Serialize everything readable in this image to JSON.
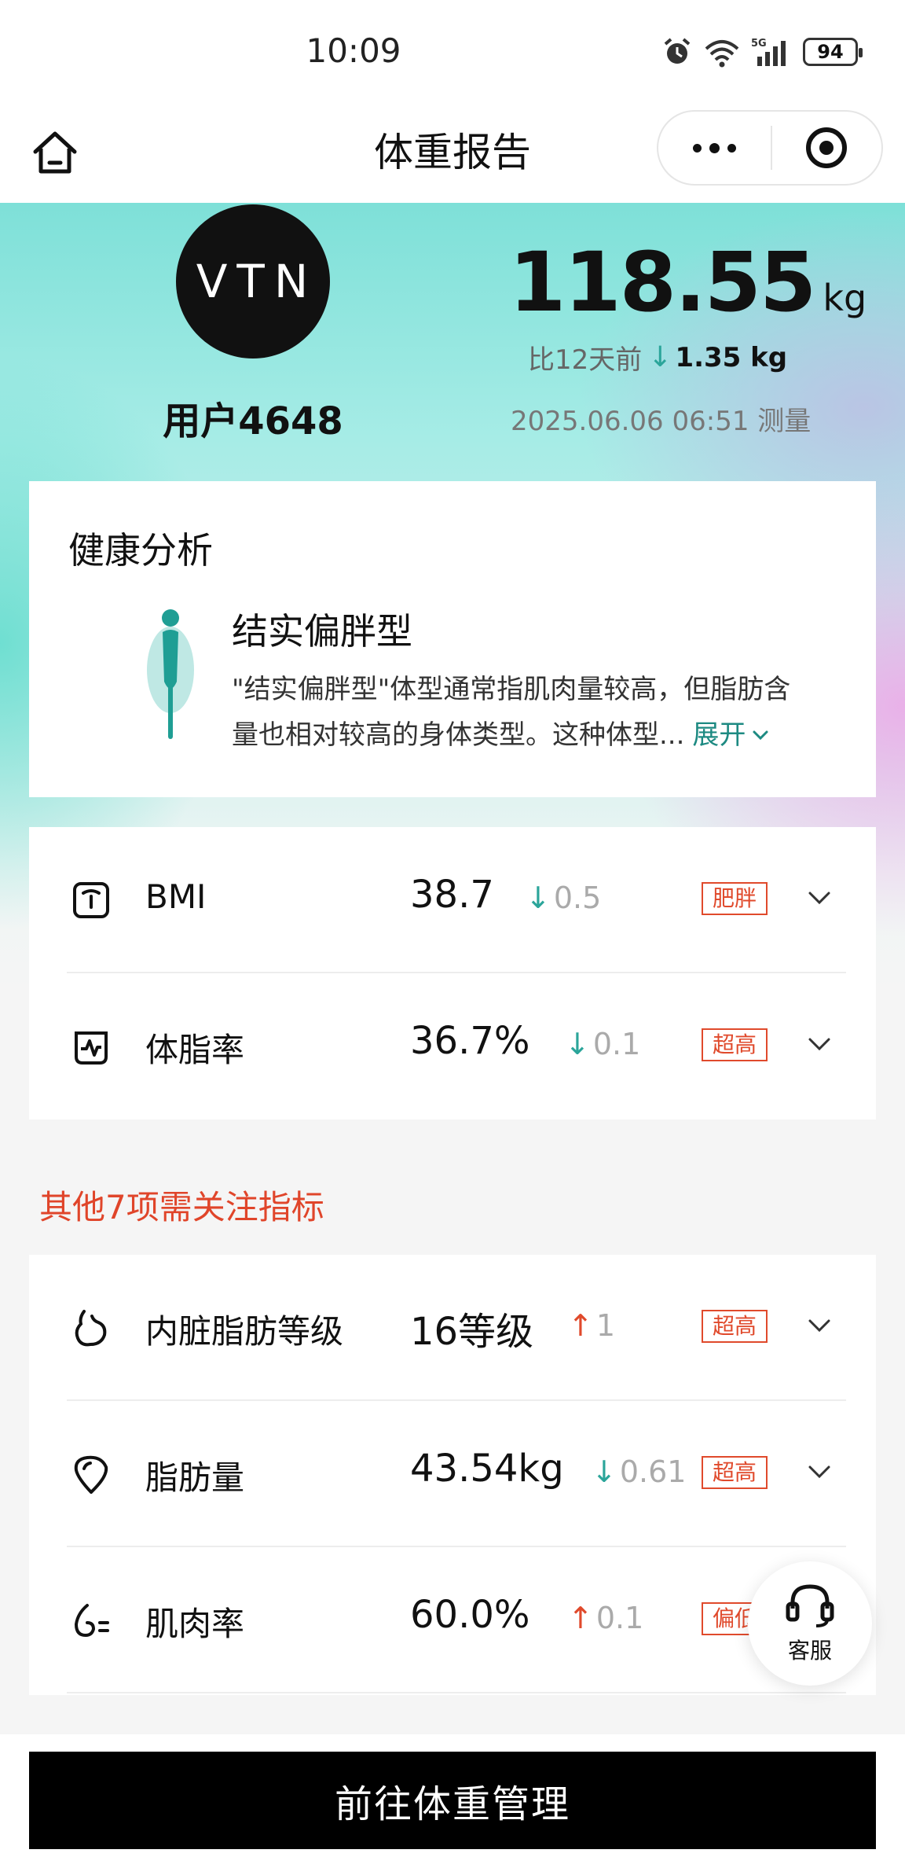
{
  "status_bar": {
    "time": "10:09",
    "battery": "94"
  },
  "nav": {
    "title": "体重报告"
  },
  "profile": {
    "logo_text": "VTN",
    "username": "用户4648",
    "weight_value": "118.55",
    "weight_unit": "kg",
    "compare_prefix": "比12天前",
    "compare_arrow": "↓",
    "compare_delta": "1.35 kg",
    "measured_at": "2025.06.06 06:51 测量"
  },
  "health": {
    "title": "健康分析",
    "type_name": "结实偏胖型",
    "desc_line1": "\"结实偏胖型\"体型通常指肌肉量较高，但脂肪含",
    "desc_line2": "量也相对较高的身体类型。这种体型...",
    "expand_label": "展开"
  },
  "key_metrics": [
    {
      "name": "BMI",
      "value": "38.7",
      "arrow": "↓",
      "change": "0.5",
      "badge": "肥胖",
      "icon": "bmi-icon"
    },
    {
      "name": "体脂率",
      "value": "36.7%",
      "arrow": "↓",
      "change": "0.1",
      "badge": "超高",
      "icon": "body-fat-icon"
    }
  ],
  "section_label": "其他7项需关注指标",
  "other_metrics": [
    {
      "name": "内脏脂肪等级",
      "value": "16等级",
      "arrow": "↑",
      "change": "1",
      "badge": "超高",
      "icon": "visceral-fat-icon"
    },
    {
      "name": "脂肪量",
      "value": "43.54kg",
      "arrow": "↓",
      "change": "0.61",
      "badge": "超高",
      "icon": "fat-mass-icon"
    },
    {
      "name": "肌肉率",
      "value": "60.0%",
      "arrow": "↑",
      "change": "0.1",
      "badge": "偏低",
      "icon": "muscle-rate-icon"
    }
  ],
  "service": {
    "label": "客服"
  },
  "cta": {
    "label": "前往体重管理"
  },
  "colors": {
    "accent_teal": "#2ba59a",
    "alert_red": "#e04a2c",
    "cta_bg": "#000000"
  }
}
